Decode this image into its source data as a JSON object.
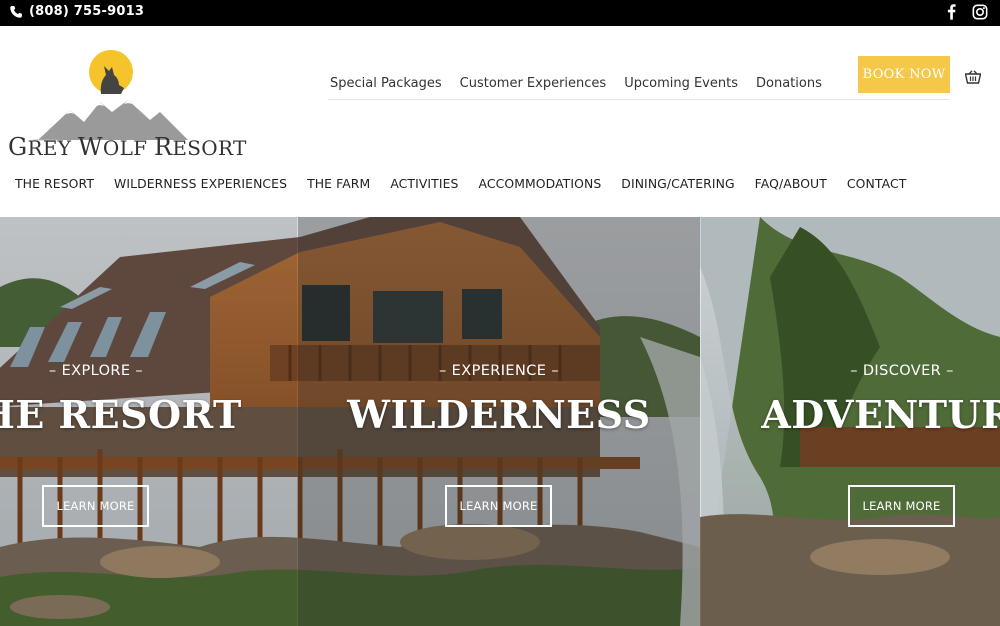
{
  "topbar": {
    "phone": "(808) 755-9013",
    "icons": [
      "phone-icon",
      "facebook-icon",
      "instagram-icon"
    ]
  },
  "header": {
    "logo_text_g": "G",
    "logo_text_rey": "REY",
    "logo_text_w": "W",
    "logo_text_olf": "OLF",
    "logo_text_r": "R",
    "logo_text_esort": "ESORT",
    "secondary_nav": [
      "Special Packages",
      "Customer Experiences",
      "Upcoming Events",
      "Donations"
    ],
    "book_now": "BOOK NOW",
    "main_nav": [
      "THE RESORT",
      "WILDERNESS EXPERIENCES",
      "THE FARM",
      "ACTIVITIES",
      "ACCOMMODATIONS",
      "DINING/CATERING",
      "FAQ/ABOUT",
      "CONTACT"
    ]
  },
  "hero": {
    "panels": [
      {
        "eyebrow": "– EXPLORE –",
        "title": "THE RESORT",
        "button": "LEARN MORE"
      },
      {
        "eyebrow": "– EXPERIENCE –",
        "title": "WILDERNESS",
        "button": "LEARN MORE"
      },
      {
        "eyebrow": "– DISCOVER –",
        "title": "ADVENTURE",
        "button": "LEARN MORE"
      }
    ]
  },
  "colors": {
    "topbar": "#000000",
    "book_button": "#f5c84a",
    "logo_sun": "#f5c32c"
  }
}
